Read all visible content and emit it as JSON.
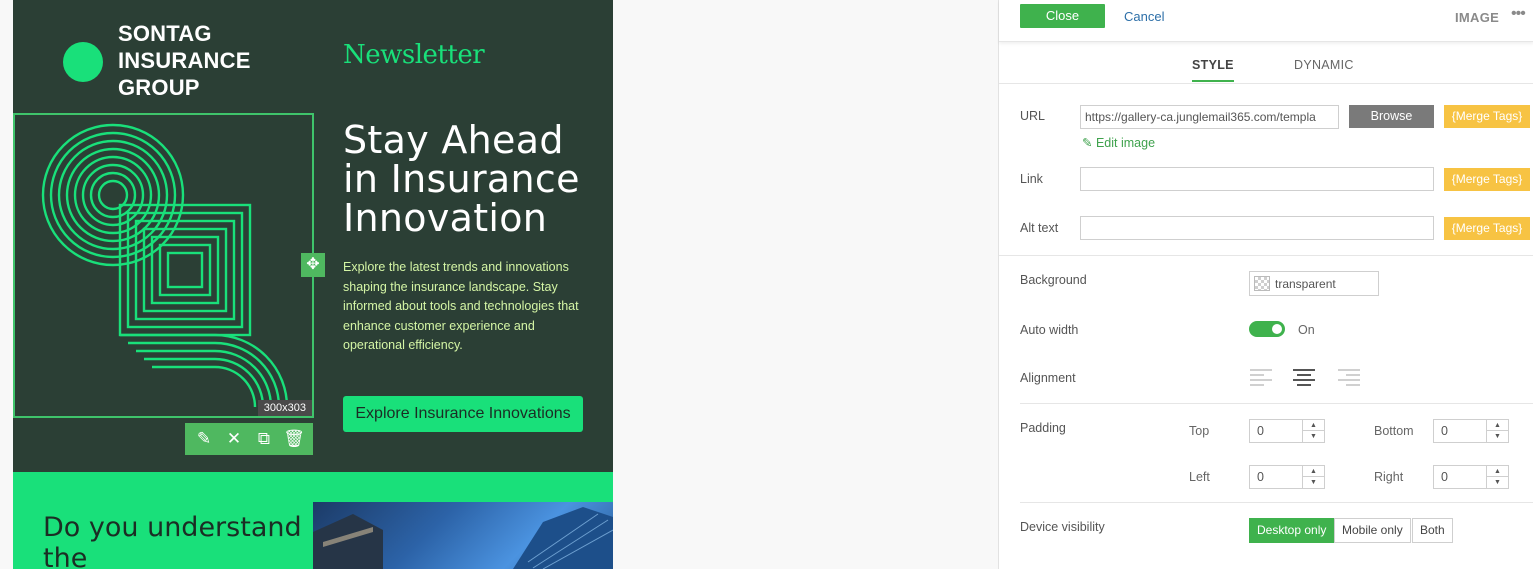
{
  "email": {
    "brand_lines": [
      "SONTAG",
      "INSURANCE",
      "GROUP"
    ],
    "newsletter": "Newsletter",
    "headline": "Stay Ahead in Insurance Innovation",
    "body": "Explore the latest trends and innovations shaping the insurance landscape. Stay informed about tools and technologies that enhance customer experience and operational efficiency.",
    "cta": "Explore Insurance Innovations",
    "image_size_badge": "300x303",
    "section_heading": "Do you understand the",
    "colors": {
      "bg": "#2b3f35",
      "accent": "#19e07a",
      "body_text": "#d4f5a5"
    }
  },
  "image_toolbar": {
    "icons": [
      "edit-icon",
      "close-icon",
      "duplicate-icon",
      "trash-icon"
    ]
  },
  "panel": {
    "close_label": "Close",
    "cancel_label": "Cancel",
    "title": "IMAGE",
    "more_glyph": "•••",
    "tabs": [
      {
        "label": "STYLE",
        "active": true
      },
      {
        "label": "DYNAMIC",
        "active": false
      }
    ],
    "url": {
      "label": "URL",
      "value": "https://gallery-ca.junglemail365.com/templa",
      "browse_label": "Browse",
      "merge_label": "{Merge Tags}",
      "edit_image_label": "Edit image"
    },
    "link": {
      "label": "Link",
      "value": "",
      "merge_label": "{Merge Tags}"
    },
    "alt": {
      "label": "Alt text",
      "value": "",
      "merge_label": "{Merge Tags}"
    },
    "background": {
      "label": "Background",
      "value": "transparent"
    },
    "auto_width": {
      "label": "Auto width",
      "state": "On",
      "on": true
    },
    "alignment": {
      "label": "Alignment",
      "options": [
        "left",
        "center",
        "right"
      ],
      "selected": "center"
    },
    "padding": {
      "label": "Padding",
      "top_label": "Top",
      "top": "0",
      "bottom_label": "Bottom",
      "bottom": "0",
      "left_label": "Left",
      "left": "0",
      "right_label": "Right",
      "right": "0"
    },
    "device_visibility": {
      "label": "Device visibility",
      "options": [
        "Desktop only",
        "Mobile only",
        "Both"
      ],
      "selected": "Desktop only"
    },
    "colors": {
      "primary_green": "#3fb24d",
      "merge_yellow": "#f7c343",
      "browse_gray": "#7a7a7a",
      "link_blue": "#2d6fa8"
    }
  }
}
